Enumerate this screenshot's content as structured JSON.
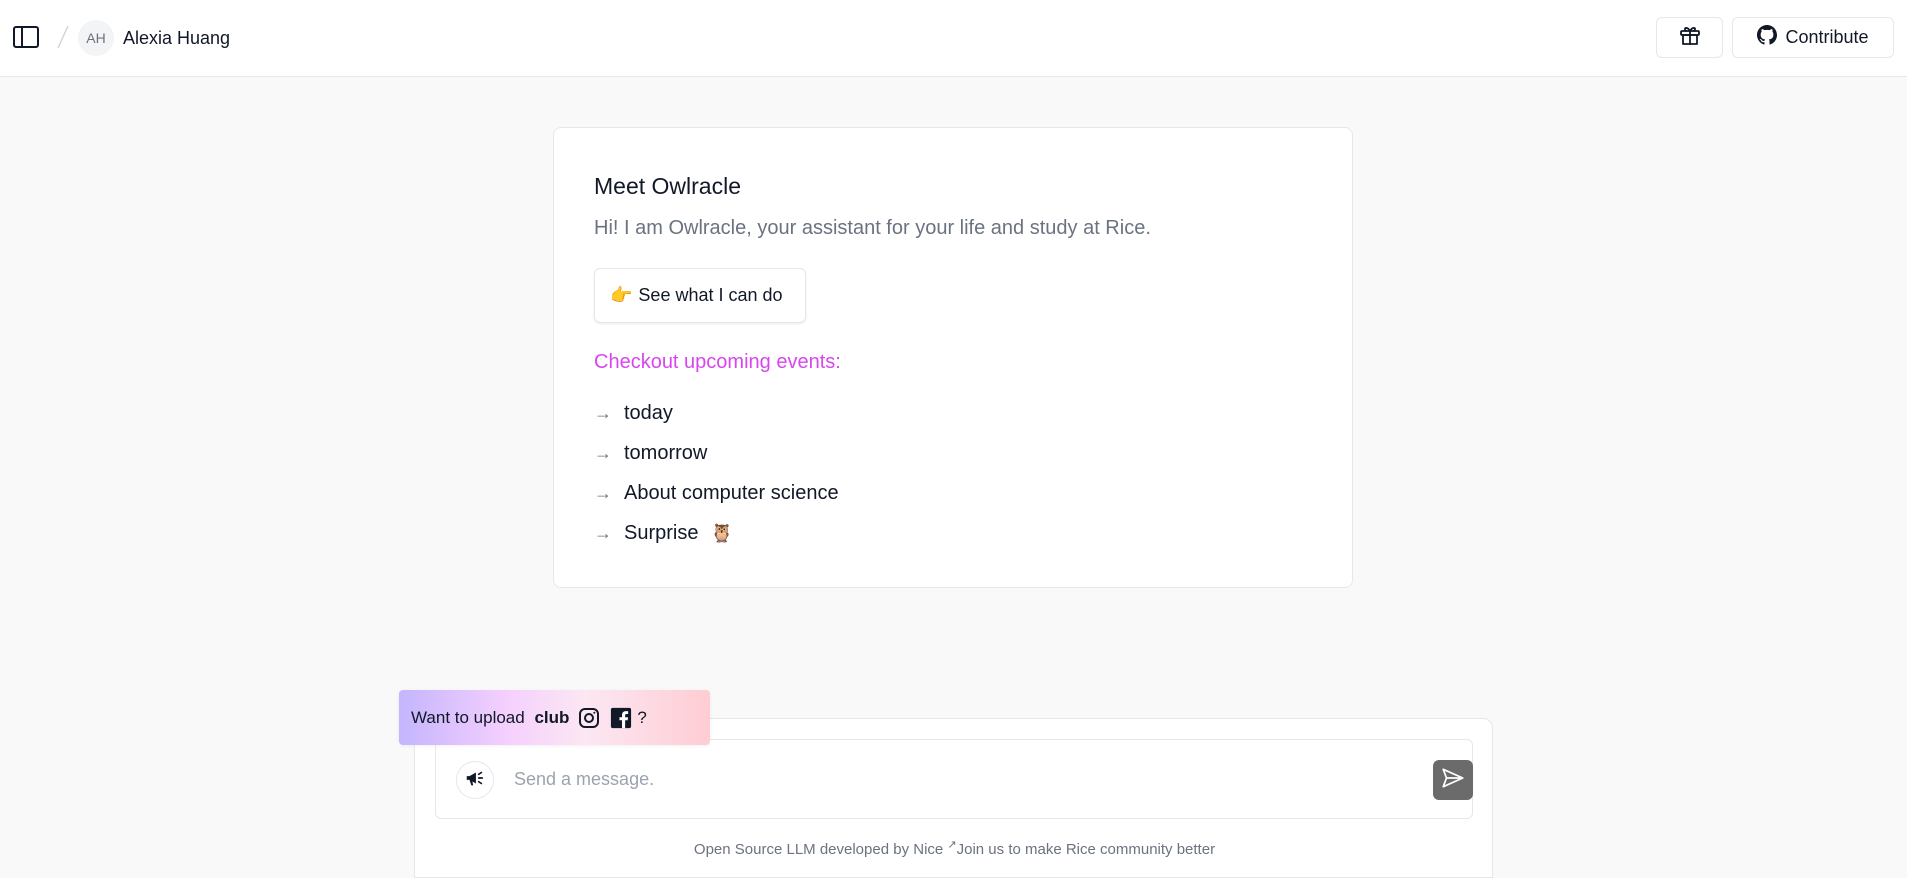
{
  "header": {
    "avatar_initials": "AH",
    "user_name": "Alexia Huang",
    "contribute_label": "Contribute",
    "icons": [
      "sidebar-toggle-icon",
      "gift-icon",
      "github-icon"
    ]
  },
  "intro": {
    "title": "Meet Owlracle",
    "subtitle": "Hi! I am Owlracle, your assistant for your life and study at Rice.",
    "cta_emoji": "👉",
    "cta_label": "See what I can do",
    "events_heading": "Checkout upcoming events:",
    "events_heading_color": "#d946ef",
    "arrow": "→",
    "events": [
      {
        "label": "today"
      },
      {
        "label": "tomorrow"
      },
      {
        "label": "About computer science"
      },
      {
        "label": "Surprise",
        "emoji": "🦉"
      }
    ]
  },
  "upload_banner": {
    "prefix": "Want to upload ",
    "bold": "club",
    "suffix": "?",
    "icons": [
      "instagram-icon",
      "facebook-icon"
    ]
  },
  "composer": {
    "placeholder": "Send a message.",
    "footer_prefix": "Open Source LLM developed by Nice ",
    "footer_sup": "↗",
    "footer_suffix": "Join us to make Rice community better"
  }
}
